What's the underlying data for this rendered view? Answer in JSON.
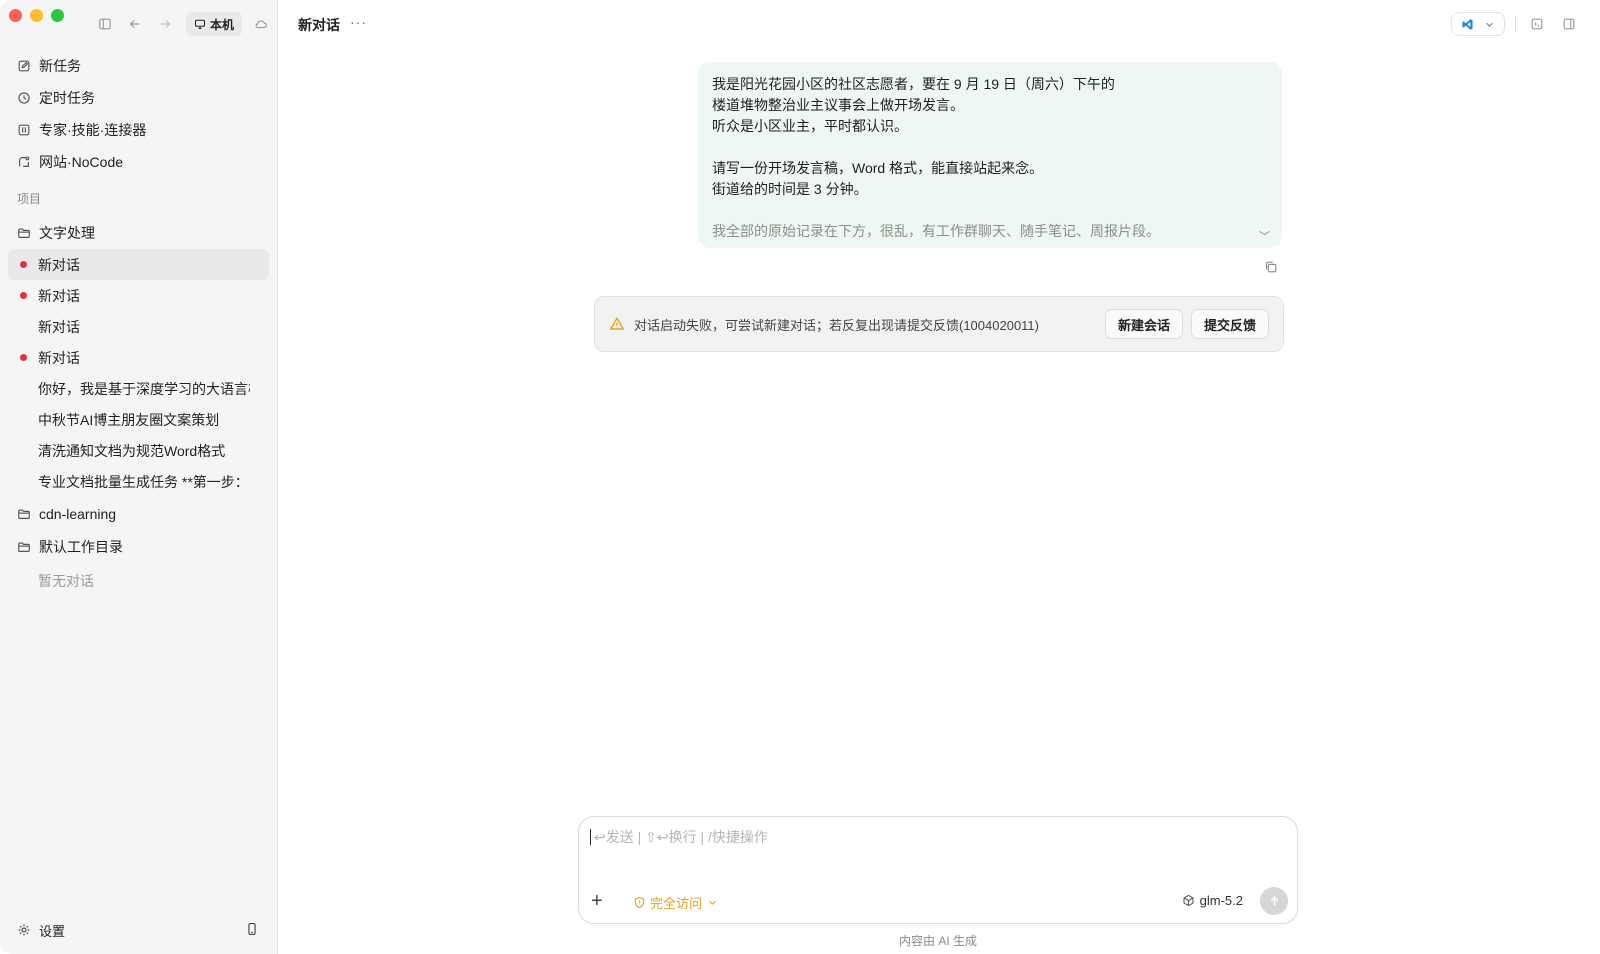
{
  "sidebar": {
    "location_label": "本机",
    "nav": [
      {
        "label": "新任务",
        "icon": "edit-icon"
      },
      {
        "label": "定时任务",
        "icon": "clock-icon"
      },
      {
        "label": "专家·技能·连接器",
        "icon": "grid-icon"
      },
      {
        "label": "网站·NoCode",
        "icon": "browser-icon"
      }
    ],
    "section_label": "项目",
    "projects": [
      {
        "name": "文字处理",
        "conversations": [
          {
            "label": "新对话",
            "unread": true,
            "active": true
          },
          {
            "label": "新对话",
            "unread": true,
            "active": false
          },
          {
            "label": "新对话",
            "unread": false,
            "active": false
          },
          {
            "label": "新对话",
            "unread": true,
            "active": false
          },
          {
            "label": "你好，我是基于深度学习的大语言模",
            "unread": false,
            "active": false
          },
          {
            "label": "中秋节AI博主朋友圈文案策划",
            "unread": false,
            "active": false
          },
          {
            "label": "清洗通知文档为规范Word格式",
            "unread": false,
            "active": false
          },
          {
            "label": "专业文档批量生成任务 **第一步：",
            "unread": false,
            "active": false
          }
        ]
      },
      {
        "name": "cdn-learning",
        "conversations": []
      },
      {
        "name": "默认工作目录",
        "conversations": [],
        "empty_label": "暂无对话"
      }
    ],
    "settings_label": "设置"
  },
  "header": {
    "title": "新对话",
    "more_label": "···"
  },
  "message": {
    "lines": [
      "我是阳光花园小区的社区志愿者，要在 9 月 19 日（周六）下午的",
      "楼道堆物整治业主议事会上做开场发言。",
      "听众是小区业主，平时都认识。",
      "",
      "请写一份开场发言稿，Word 格式，能直接站起来念。",
      "街道给的时间是 3 分钟。",
      "",
      "我全部的原始记录在下方，很乱，有工作群聊天、随手笔记、周报片段。"
    ]
  },
  "error": {
    "text": "对话启动失败，可尝试新建对话；若反复出现请提交反馈(1004020011)",
    "new_session_label": "新建会话",
    "feedback_label": "提交反馈"
  },
  "composer": {
    "placeholder": "↩发送 | ⇧↩换行 | /快捷操作",
    "value": "",
    "access_label": "完全访问",
    "model_label": "glm-5.2"
  },
  "disclaimer": "内容由 AI 生成",
  "colors": {
    "accent_warning": "#e8a21b",
    "unread_dot": "#e0313f",
    "bubble_bg": "#eef7f1",
    "ide_blue": "#1f8ad2"
  }
}
